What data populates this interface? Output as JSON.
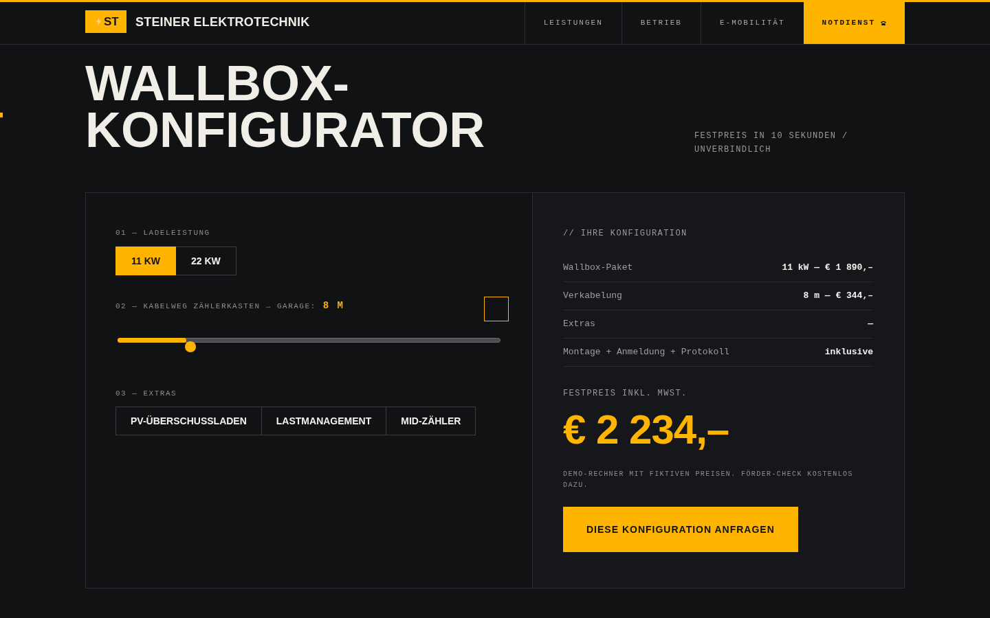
{
  "header": {
    "logo": {
      "text": "ST"
    },
    "brand": "STEINER ELEKTROTECHNIK",
    "nav": [
      {
        "label": "LEISTUNGEN",
        "kind": "link"
      },
      {
        "label": "BETRIEB",
        "kind": "link"
      },
      {
        "label": "E-MOBILITÄT",
        "kind": "link"
      },
      {
        "label": "NOTDIENST",
        "kind": "emergency"
      }
    ]
  },
  "hero": {
    "title": "WALLBOX-KONFIGURATOR",
    "subtitle": "FESTPREIS IN 10 SEKUNDEN / UNVERBINDLICH"
  },
  "configurator": {
    "power": {
      "label": "01 — LADELEISTUNG",
      "options": [
        {
          "label": "11 KW",
          "selected": true
        },
        {
          "label": "22 KW",
          "selected": false
        }
      ]
    },
    "cable": {
      "label": "02 — KABELWEG ZÄHLERKASTEN → GARAGE:",
      "value": "8 M",
      "level": 0.18
    },
    "extras": {
      "label": "03 — EXTRAS",
      "options": [
        {
          "label": "PV-ÜBERSCHUSSLADEN",
          "selected": false
        },
        {
          "label": "LASTMANAGEMENT",
          "selected": false
        },
        {
          "label": "MID-ZÄHLER",
          "selected": false
        }
      ]
    }
  },
  "summary": {
    "heading": "// IHRE KONFIGURATION",
    "rows": [
      {
        "label": "Wallbox-Paket",
        "value": "11 kW — € 1 890,–"
      },
      {
        "label": "Verkabelung",
        "value": "8 m — € 344,–"
      },
      {
        "label": "Extras",
        "value": "—"
      },
      {
        "label": "Montage + Anmeldung + Protokoll",
        "value": "inklusive"
      }
    ],
    "price_label": "FESTPREIS INKL. MWST.",
    "price": "€ 2 234,–",
    "note": "DEMO-RECHNER MIT FIKTIVEN PREISEN. FÖRDER-CHECK KOSTENLOS DAZU.",
    "cta": "DIESE KONFIGURATION ANFRAGEN"
  }
}
